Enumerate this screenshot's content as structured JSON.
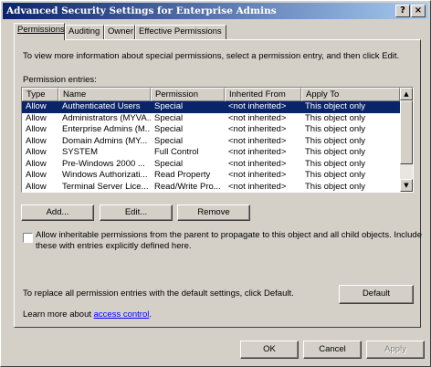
{
  "window": {
    "title": "Advanced Security Settings for Enterprise Admins",
    "help_label": "?",
    "close_label": "×"
  },
  "tabs": [
    {
      "label": "Permissions"
    },
    {
      "label": "Auditing"
    },
    {
      "label": "Owner"
    },
    {
      "label": "Effective Permissions"
    }
  ],
  "permissions": {
    "intro": "To view more information about special permissions, select a permission entry, and then click Edit.",
    "entries_label": "Permission entries:",
    "columns": [
      "Type",
      "Name",
      "Permission",
      "Inherited From",
      "Apply To"
    ],
    "rows": [
      {
        "type": "Allow",
        "name": "Authenticated Users",
        "permission": "Special",
        "inherited": "<not inherited>",
        "apply": "This object only"
      },
      {
        "type": "Allow",
        "name": "Administrators (MYVA...",
        "permission": "Special",
        "inherited": "<not inherited>",
        "apply": "This object only"
      },
      {
        "type": "Allow",
        "name": "Enterprise Admins (M...",
        "permission": "Special",
        "inherited": "<not inherited>",
        "apply": "This object only"
      },
      {
        "type": "Allow",
        "name": "Domain Admins (MY...",
        "permission": "Special",
        "inherited": "<not inherited>",
        "apply": "This object only"
      },
      {
        "type": "Allow",
        "name": "SYSTEM",
        "permission": "Full Control",
        "inherited": "<not inherited>",
        "apply": "This object only"
      },
      {
        "type": "Allow",
        "name": "Pre-Windows 2000 ...",
        "permission": "Special",
        "inherited": "<not inherited>",
        "apply": "This object only"
      },
      {
        "type": "Allow",
        "name": "Windows Authorizati...",
        "permission": "Read Property",
        "inherited": "<not inherited>",
        "apply": "This object only"
      },
      {
        "type": "Allow",
        "name": "Terminal Server Lice...",
        "permission": "Read/Write Pro...",
        "inherited": "<not inherited>",
        "apply": "This object only"
      }
    ],
    "add_label": "Add...",
    "edit_label": "Edit...",
    "remove_label": "Remove",
    "inherit_checkbox_label_line1": "Allow inheritable permissions from the parent to propagate to this object and all child objects. Include",
    "inherit_checkbox_label_line2": "these with entries explicitly defined here.",
    "inherit_checked": false,
    "default_text": "To replace all permission entries with the default settings, click Default.",
    "default_label": "Default",
    "learn_prefix": "Learn more about",
    "learn_link": "access control",
    "learn_suffix": "."
  },
  "footer": {
    "ok_label": "OK",
    "cancel_label": "Cancel",
    "apply_label": "Apply"
  },
  "colors": {
    "dialog_bg": "#d4d0c8",
    "title_start": "#0a246a",
    "title_end": "#a6caf0",
    "selection": "#0a246a",
    "link": "#0000ff"
  }
}
